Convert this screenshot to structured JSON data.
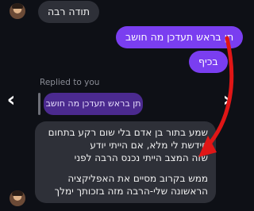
{
  "messages": {
    "incoming_top": "תודה רבה",
    "outgoing_1": "תן בראש תעדכן מה חושב",
    "outgoing_2": "בכיף",
    "reply_label": "Replied to you",
    "reply_quote": "תן בראש תעדכן מה חושב",
    "reply_body_lines": [
      "שמע בתור בן אדם בלי שום רקע בתחום",
      "חידשת לי מלא, אם הייתי יודע",
      "שזה המצב הייתי נכנס הרבה לפני",
      "",
      "ממש בקרוב מסיים את האפליקציה",
      "הראשונה שלי-הרבה מזה בזכותך ימלך"
    ]
  },
  "nav": {
    "prev": "‹",
    "next": "›"
  },
  "colors": {
    "background": "#0e1016",
    "incoming_bubble": "#2e3038",
    "outgoing_bubble": "#7a3ef0",
    "quote_bubble": "#4b2a8f",
    "annotation_arrow": "#e01616"
  }
}
